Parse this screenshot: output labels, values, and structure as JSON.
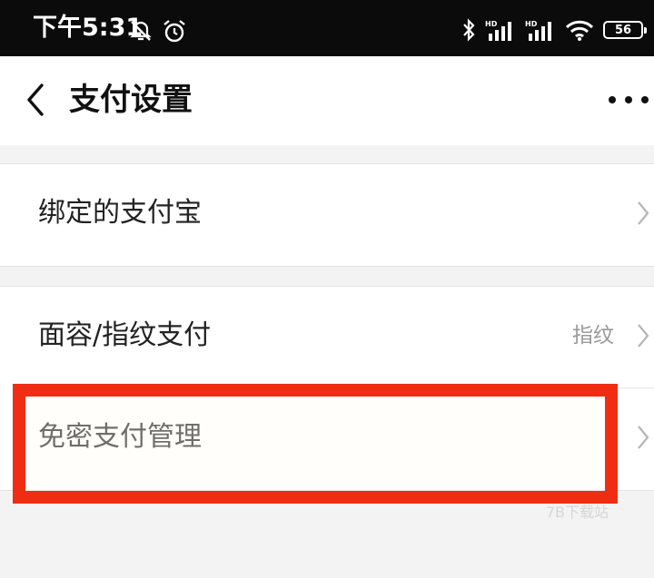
{
  "status_bar": {
    "time": "下午5:31",
    "battery": "56",
    "icons": [
      "mute-icon",
      "alarm-icon",
      "bluetooth-icon",
      "signal-icon",
      "signal-icon",
      "wifi-icon",
      "battery-icon"
    ]
  },
  "nav": {
    "title": "支付设置",
    "back_icon": "back-arrow-icon",
    "more_icon": "more-icon"
  },
  "groups": [
    {
      "items": [
        {
          "label": "绑定的支付宝",
          "value": ""
        }
      ]
    },
    {
      "items": [
        {
          "label": "面容/指纹支付",
          "value": "指纹"
        },
        {
          "label": "免密支付管理",
          "value": ""
        }
      ]
    }
  ],
  "annotation": {
    "highlight_color": "#f02d12"
  },
  "watermark": "7B下载站"
}
